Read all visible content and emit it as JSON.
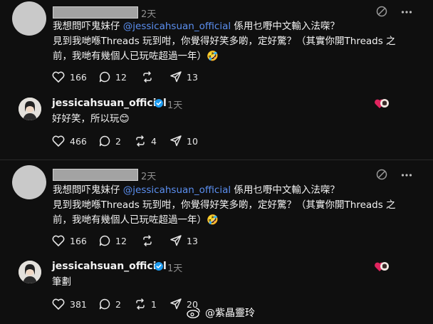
{
  "thread1": {
    "question": {
      "time": "2天",
      "line1_pre": "我想問吓鬼妹仔 ",
      "line1_mention": "@jessicahsuan_official",
      "line1_post": " 係用乜嘢中文輸入法㗎？",
      "line2": "見到我哋喺Threads 玩到咁，你覺得好笑多啲，定好驚？（其實你開Threads 之",
      "line3": "前，我哋有幾個人已玩咗超過一年）🤣",
      "likes": "166",
      "replies": "12",
      "shares": "13"
    },
    "reply": {
      "username": "jessicahsuan_official",
      "time": "1天",
      "text": "好好笑，所以玩😊",
      "likes": "466",
      "replies": "2",
      "reposts": "4",
      "shares": "10"
    }
  },
  "thread2": {
    "question": {
      "time": "2天",
      "line1_pre": "我想問吓鬼妹仔 ",
      "line1_mention": "@jessicahsuan_official",
      "line1_post": " 係用乜嘢中文輸入法㗎？",
      "line2": "見到我哋喺Threads 玩到咁，你覺得好笑多啲，定好驚？（其實你開Threads 之",
      "line3": "前，我哋有幾個人已玩咗超過一年）🤣",
      "likes": "166",
      "replies": "12",
      "shares": "13"
    },
    "reply": {
      "username": "jessicahsuan_official",
      "time": "1天",
      "text": "筆劃",
      "likes": "381",
      "replies": "2",
      "reposts": "1",
      "shares": "20"
    }
  },
  "watermark": "@紫晶靈玲",
  "icons": {
    "like": "heart-icon",
    "reply": "comment-icon",
    "repost": "repost-icon",
    "share": "send-icon",
    "mute": "mute-icon",
    "more": "more-icon"
  },
  "colors": {
    "background": "#0f0f0f",
    "mention": "#5b8ff0",
    "verified": "#1d9bf0",
    "muted_text": "#8e8e8e"
  }
}
